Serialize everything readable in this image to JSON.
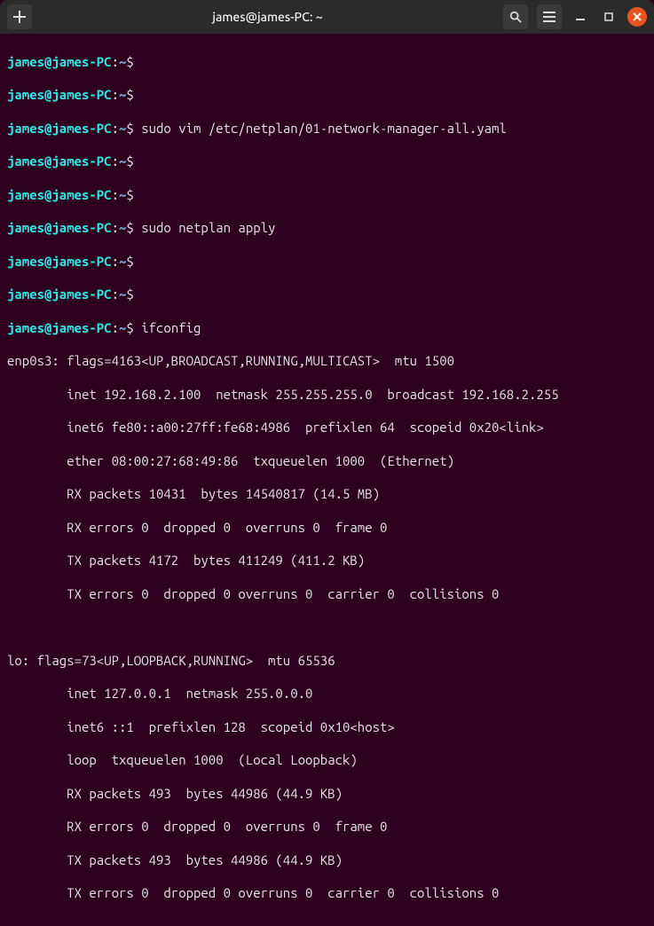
{
  "window": {
    "title": "james@james-PC: ~"
  },
  "prompt": {
    "userhost": "james@james-PC",
    "sep1": ":",
    "path": "~",
    "sigil": "$"
  },
  "lines": {
    "cmd1": "",
    "cmd2": "",
    "cmd3": "sudo vim /etc/netplan/01-network-manager-all.yaml",
    "cmd4": "",
    "cmd5": "",
    "cmd6": "sudo netplan apply",
    "cmd7": "",
    "cmd8": "",
    "cmd9": "ifconfig"
  },
  "ifconfig": {
    "if1_l1": "enp0s3: flags=4163<UP,BROADCAST,RUNNING,MULTICAST>  mtu 1500",
    "if1_l2": "        inet 192.168.2.100  netmask 255.255.255.0  broadcast 192.168.2.255",
    "if1_l3": "        inet6 fe80::a00:27ff:fe68:4986  prefixlen 64  scopeid 0x20<link>",
    "if1_l4": "        ether 08:00:27:68:49:86  txqueuelen 1000  (Ethernet)",
    "if1_l5": "        RX packets 10431  bytes 14540817 (14.5 MB)",
    "if1_l6": "        RX errors 0  dropped 0  overruns 0  frame 0",
    "if1_l7": "        TX packets 4172  bytes 411249 (411.2 KB)",
    "if1_l8": "        TX errors 0  dropped 0 overruns 0  carrier 0  collisions 0",
    "blank": " ",
    "if2_l1": "lo: flags=73<UP,LOOPBACK,RUNNING>  mtu 65536",
    "if2_l2": "        inet 127.0.0.1  netmask 255.0.0.0",
    "if2_l3": "        inet6 ::1  prefixlen 128  scopeid 0x10<host>",
    "if2_l4": "        loop  txqueuelen 1000  (Local Loopback)",
    "if2_l5": "        RX packets 493  bytes 44986 (44.9 KB)",
    "if2_l6": "        RX errors 0  dropped 0  overruns 0  frame 0",
    "if2_l7": "        TX packets 493  bytes 44986 (44.9 KB)",
    "if2_l8": "        TX errors 0  dropped 0 overruns 0  carrier 0  collisions 0"
  }
}
